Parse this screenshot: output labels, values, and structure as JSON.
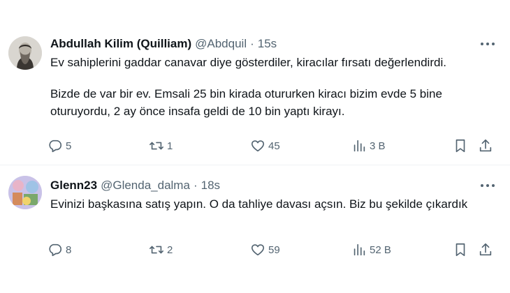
{
  "tweets": [
    {
      "author": "Abdullah Kilim (Quilliam)",
      "handle": "@Abdquil",
      "separator": "·",
      "time": "15s",
      "body": [
        "Ev sahiplerini gaddar canavar diye gösterdiler, kiracılar fırsatı değerlendirdi.",
        "Bizde de var bir ev. Emsali 25 bin kirada otururken kiracı bizim evde 5 bine oturuyordu, 2 ay önce insafa geldi de 10 bin yaptı kirayı."
      ],
      "replies": "5",
      "reposts": "1",
      "likes": "45",
      "views": "3 B"
    },
    {
      "author": "Glenn23",
      "handle": "@Glenda_dalma",
      "separator": "·",
      "time": "18s",
      "body": [
        "Evinizi başkasına satış yapın. O da tahliye davası açsın. Biz bu şekilde çıkardık"
      ],
      "replies": "8",
      "reposts": "2",
      "likes": "59",
      "views": "52 B"
    }
  ],
  "icons": {
    "reply": "reply-icon",
    "repost": "repost-icon",
    "like": "heart-icon",
    "views": "views-icon",
    "bookmark": "bookmark-icon",
    "share": "share-icon",
    "more": "more-icon"
  },
  "colors": {
    "text": "#0f1419",
    "secondary": "#536471",
    "divider": "#eff3f4"
  }
}
